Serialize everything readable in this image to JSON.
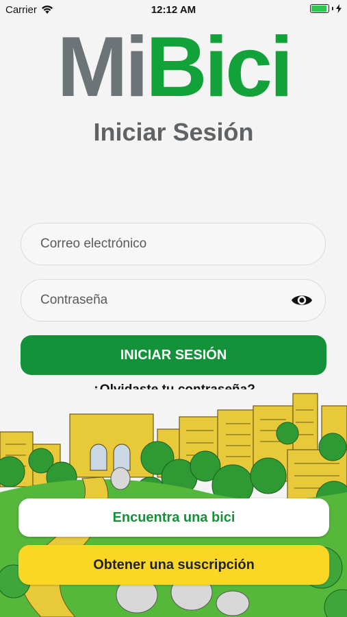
{
  "status_bar": {
    "carrier": "Carrier",
    "time": "12:12 AM"
  },
  "logo": {
    "part1": "Mi",
    "part2": "Bici"
  },
  "title": "Iniciar Sesión",
  "form": {
    "email_placeholder": "Correo electrónico",
    "password_placeholder": "Contraseña",
    "submit_label": "INICIAR SESIÓN",
    "forgot_label": "¿Olvidaste tu contraseña?"
  },
  "actions": {
    "find_bike_label": "Encuentra una bici",
    "subscription_label": "Obtener una suscripción"
  },
  "colors": {
    "brand_green": "#13a23a",
    "button_green": "#13923a",
    "brand_gray": "#6d7477",
    "accent_yellow": "#fad625"
  },
  "icons": [
    "wifi-icon",
    "battery-icon",
    "charging-icon",
    "eye-icon"
  ]
}
